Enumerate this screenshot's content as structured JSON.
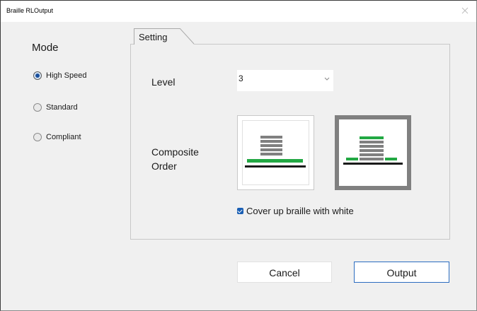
{
  "window": {
    "title": "Braille RLOutput",
    "close_icon": "close-icon"
  },
  "mode": {
    "label": "Mode",
    "options": [
      {
        "label": "High Speed",
        "checked": true
      },
      {
        "label": "Standard",
        "checked": false
      },
      {
        "label": "Compliant",
        "checked": false
      }
    ]
  },
  "setting_tab": {
    "label": "Setting"
  },
  "level": {
    "label": "Level",
    "value": "3"
  },
  "composite_order": {
    "label_line1": "Composite",
    "label_line2": "Order",
    "options": [
      {
        "name": "composite-order-option-braille-on-top",
        "selected": false
      },
      {
        "name": "composite-order-option-braille-in-middle",
        "selected": true
      }
    ]
  },
  "cover_up": {
    "label": "Cover up braille with white",
    "checked": true
  },
  "buttons": {
    "cancel": "Cancel",
    "output": "Output"
  },
  "colors": {
    "green": "#22a843",
    "gray_bar": "#808080",
    "black_line": "#1a1a1a",
    "accent": "#2b6cc0"
  }
}
